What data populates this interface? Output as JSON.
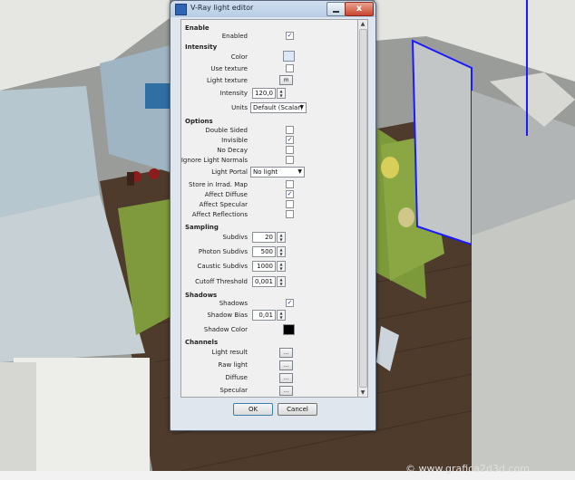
{
  "window": {
    "title": "V-Ray light editor",
    "close_glyph": "x"
  },
  "sections": {
    "enable": "Enable",
    "intensity": "Intensity",
    "options": "Options",
    "sampling": "Sampling",
    "shadows": "Shadows",
    "channels": "Channels"
  },
  "enable": {
    "enabled_label": "Enabled",
    "enabled_checked": true
  },
  "intensity": {
    "color_label": "Color",
    "color_value": "#d9e8f8",
    "use_texture_label": "Use texture",
    "use_texture_checked": false,
    "light_texture_label": "Light texture",
    "light_texture_button": "m",
    "intensity_label": "Intensity",
    "intensity_value": "120,0",
    "units_label": "Units",
    "units_value": "Default (Scalar)"
  },
  "options": {
    "double_sided_label": "Double Sided",
    "double_sided_checked": false,
    "invisible_label": "Invisible",
    "invisible_checked": true,
    "no_decay_label": "No Decay",
    "no_decay_checked": false,
    "ignore_light_normals_label": "Ignore Light Normals",
    "ignore_light_normals_checked": false,
    "light_portal_label": "Light Portal",
    "light_portal_value": "No light",
    "store_irrad_label": "Store in Irrad. Map",
    "store_irrad_checked": false,
    "affect_diffuse_label": "Affect Diffuse",
    "affect_diffuse_checked": true,
    "affect_specular_label": "Affect Specular",
    "affect_specular_checked": false,
    "affect_reflections_label": "Affect Reflections",
    "affect_reflections_checked": false
  },
  "sampling": {
    "subdivs_label": "Subdivs",
    "subdivs_value": "20",
    "photon_subdivs_label": "Photon Subdivs",
    "photon_subdivs_value": "500",
    "caustic_subdivs_label": "Caustic Subdivs",
    "caustic_subdivs_value": "1000",
    "cutoff_label": "Cutoff Threshold",
    "cutoff_value": "0,001"
  },
  "shadows": {
    "shadows_label": "Shadows",
    "shadows_checked": true,
    "shadow_bias_label": "Shadow Bias",
    "shadow_bias_value": "0,01",
    "shadow_color_label": "Shadow Color",
    "shadow_color_value": "#000000"
  },
  "channels": {
    "light_result_label": "Light result",
    "raw_light_label": "Raw light",
    "diffuse_label": "Diffuse",
    "specular_label": "Specular",
    "button_label": "..."
  },
  "buttons": {
    "ok": "OK",
    "cancel": "Cancel"
  },
  "watermark": "© www.grafica2d3d.com",
  "colors": {
    "titlebar": "#b7cde4",
    "panel": "#f0f0f0",
    "accent": "#3c7fb1"
  }
}
